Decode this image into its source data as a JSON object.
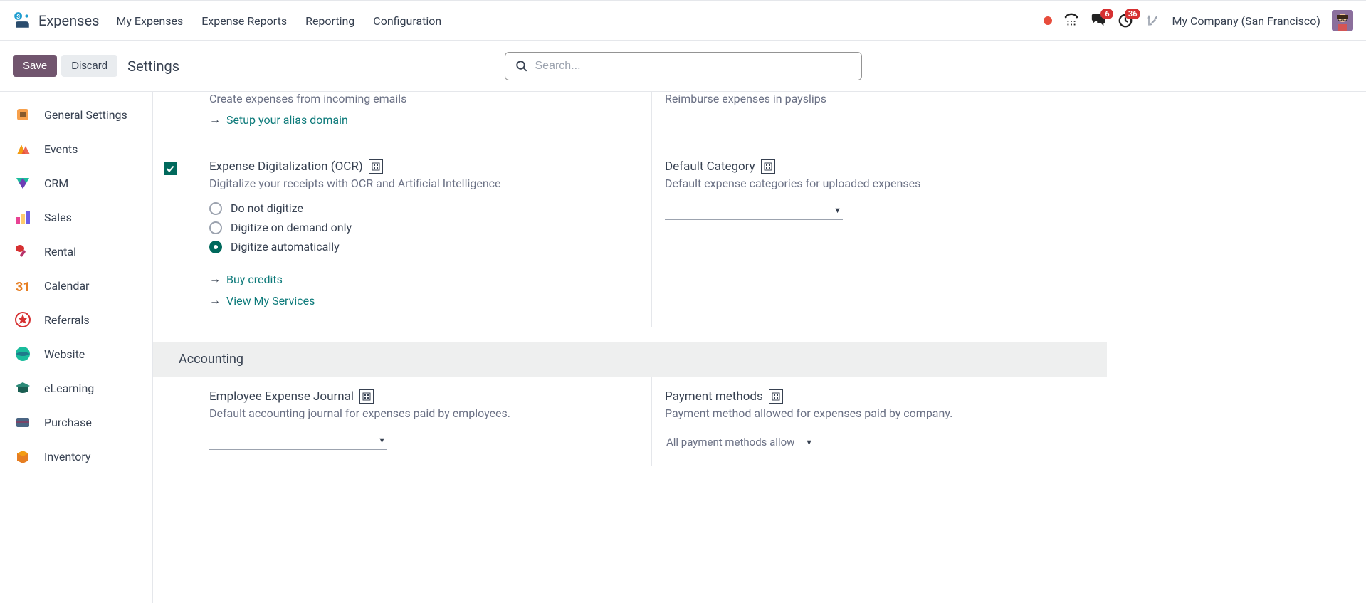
{
  "header": {
    "app_title": "Expenses",
    "nav": [
      "My Expenses",
      "Expense Reports",
      "Reporting",
      "Configuration"
    ],
    "company": "My Company (San Francisco)",
    "badges": {
      "chat": "6",
      "clock": "36"
    }
  },
  "control": {
    "save": "Save",
    "discard": "Discard",
    "page_title": "Settings",
    "search_placeholder": "Search..."
  },
  "sidebar": [
    {
      "label": "General Settings"
    },
    {
      "label": "Events"
    },
    {
      "label": "CRM"
    },
    {
      "label": "Sales"
    },
    {
      "label": "Rental"
    },
    {
      "label": "Calendar"
    },
    {
      "label": "Referrals"
    },
    {
      "label": "Website"
    },
    {
      "label": "eLearning"
    },
    {
      "label": "Purchase"
    },
    {
      "label": "Inventory"
    }
  ],
  "settings": {
    "top_left_desc": "Create expenses from incoming emails",
    "top_left_link": "Setup your alias domain",
    "top_right_desc": "Reimburse expenses in payslips",
    "ocr": {
      "title": "Expense Digitalization (OCR)",
      "desc": "Digitalize your receipts with OCR and Artificial Intelligence",
      "options": [
        "Do not digitize",
        "Digitize on demand only",
        "Digitize automatically"
      ],
      "selected": 2,
      "links": [
        "Buy credits",
        "View My Services"
      ]
    },
    "default_category": {
      "title": "Default Category",
      "desc": "Default expense categories for uploaded expenses",
      "value": ""
    },
    "accounting_header": "Accounting",
    "journal": {
      "title": "Employee Expense Journal",
      "desc": "Default accounting journal for expenses paid by employees.",
      "value": ""
    },
    "payment": {
      "title": "Payment methods",
      "desc": "Payment method allowed for expenses paid by company.",
      "value": "All payment methods allow"
    }
  }
}
